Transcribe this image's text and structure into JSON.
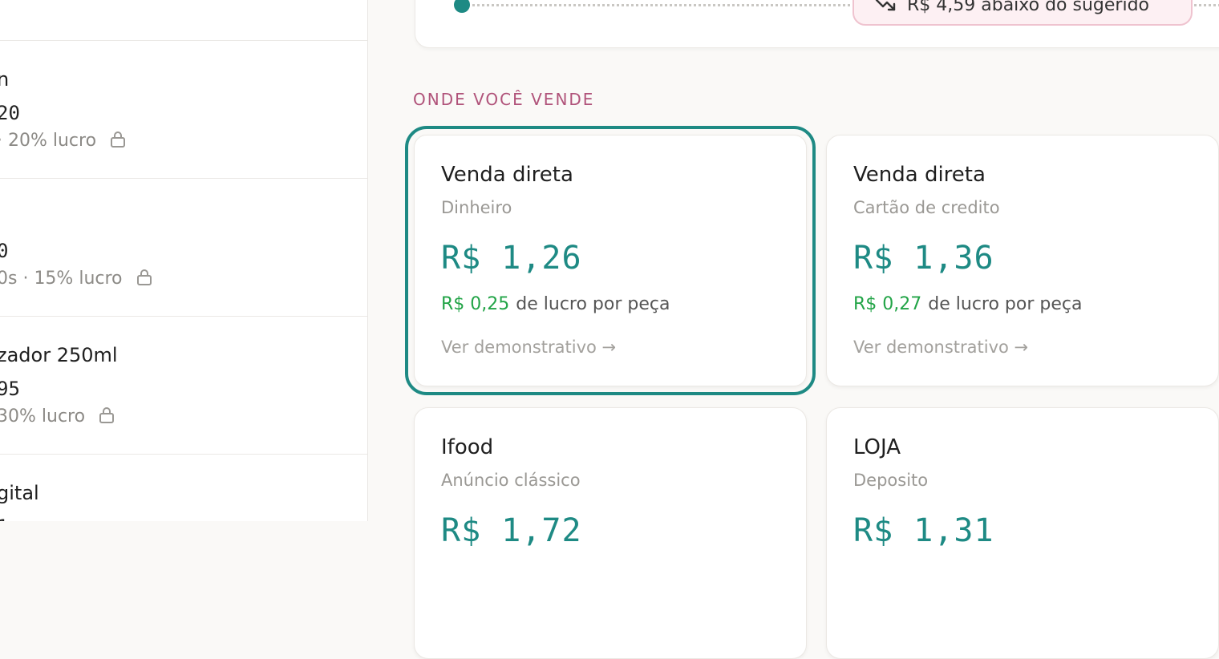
{
  "sidebar": {
    "items": [
      {
        "name": "",
        "price": "",
        "meta": "",
        "locked": false
      },
      {
        "name": "n",
        "price": "20",
        "meta": "· 20% lucro",
        "locked": true
      },
      {
        "name": "",
        "price": "0",
        "meta": "0s · 15% lucro",
        "locked": true
      },
      {
        "name": "zador 250ml",
        "price": "95",
        "meta": "30% lucro",
        "locked": true
      },
      {
        "name": "gital",
        "price": "1",
        "meta": "",
        "locked": false
      }
    ]
  },
  "price_slider": {
    "badge_text": "R$ 4,59 abaixo do sugerido",
    "badge_icon": "trending-down-icon"
  },
  "section": {
    "label": "Onde você vende"
  },
  "channels": [
    {
      "name": "Venda direta",
      "subtitle": "Dinheiro",
      "price": "R$ 1,26",
      "profit_value": "R$ 0,25",
      "profit_text": "de lucro por peça",
      "link": "Ver demonstrativo →",
      "selected": true
    },
    {
      "name": "Venda direta",
      "subtitle": "Cartão de credito",
      "price": "R$ 1,36",
      "profit_value": "R$ 0,27",
      "profit_text": "de lucro por peça",
      "link": "Ver demonstrativo →",
      "selected": false
    },
    {
      "name": "Ifood",
      "subtitle": "Anúncio clássico",
      "price": "R$ 1,72",
      "profit_value": "",
      "profit_text": "",
      "link": "",
      "selected": false
    },
    {
      "name": "LOJA",
      "subtitle": "Deposito",
      "price": "R$ 1,31",
      "profit_value": "",
      "profit_text": "",
      "link": "",
      "selected": false
    }
  ],
  "colors": {
    "accent": "#1e8a84",
    "profit": "#22a447",
    "section_label": "#b0537a",
    "badge_bg": "#fdf0f3"
  }
}
